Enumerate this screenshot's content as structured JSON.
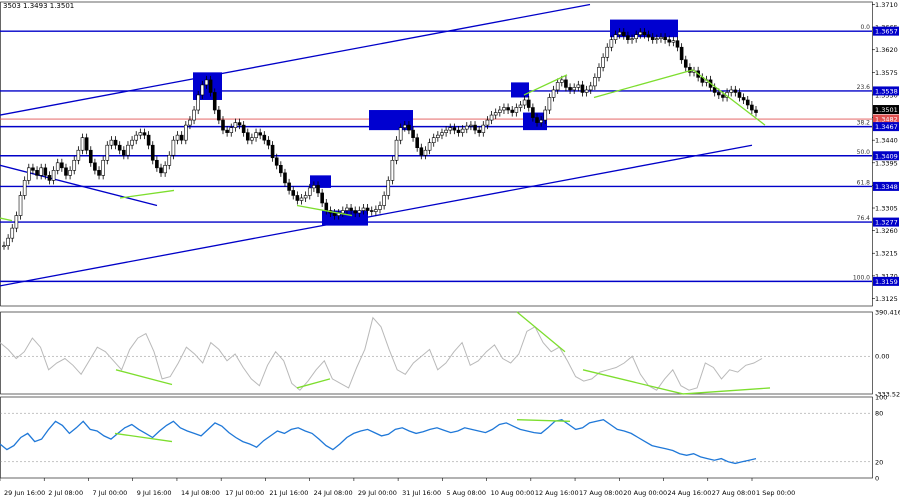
{
  "header": {
    "quote": "3503 1.3493 1.3501"
  },
  "colors": {
    "background": "#ffffff",
    "candle": "#000000",
    "level_line": "#0000c8",
    "box": "#0000d0",
    "divergence": "#7dde2e",
    "red_line": "#e05050",
    "cci_line": "#b9b9b9",
    "stoch_line": "#1f78d8",
    "grid_dash": "#888888"
  },
  "chart_data": [
    {
      "type": "line",
      "name": "price",
      "instrument_quote": "1.3493 1.3501",
      "x_labels": [
        "29 Jun 16:00",
        "2 Jul 08:00",
        "7 Jul 00:00",
        "9 Jul 16:00",
        "14 Jul 08:00",
        "17 Jul 00:00",
        "21 Jul 16:00",
        "24 Jul 08:00",
        "29 Jul 00:00",
        "31 Jul 16:00",
        "5 Aug 08:00",
        "10 Aug 00:00",
        "12 Aug 16:00",
        "17 Aug 08:00",
        "20 Aug 00:00",
        "24 Aug 16:00",
        "27 Aug 08:00",
        "1 Sep 00:00"
      ],
      "y_ticks": [
        1.3125,
        1.317,
        1.3215,
        1.326,
        1.3305,
        1.335,
        1.3395,
        1.344,
        1.3485,
        1.353,
        1.3575,
        1.362,
        1.3665,
        1.371
      ],
      "ylim": [
        1.311,
        1.3715
      ],
      "current_price": 1.3501,
      "red_line_price": 1.3482,
      "fib_levels": [
        {
          "label": "0.0",
          "price": 1.3657
        },
        {
          "label": "23.6",
          "price": 1.3538
        },
        {
          "label": "38.2",
          "price": 1.3467
        },
        {
          "label": "50.0",
          "price": 1.3409
        },
        {
          "label": "61.8",
          "price": 1.3348
        },
        {
          "label": "76.4",
          "price": 1.3277
        },
        {
          "label": "100.0",
          "price": 1.3159
        }
      ],
      "channel": {
        "upper_start": 1.349,
        "upper_end": 1.371,
        "lower_start": 1.315,
        "lower_end": 1.343
      },
      "series": [
        {
          "values": [
            1.323,
            1.3245,
            1.3265,
            1.329,
            1.333,
            1.336,
            1.3385,
            1.338,
            1.337,
            1.3385,
            1.337,
            1.336,
            1.338,
            1.3395,
            1.3385,
            1.337,
            1.338,
            1.34,
            1.342,
            1.3445,
            1.342,
            1.3395,
            1.338,
            1.337,
            1.34,
            1.343,
            1.344,
            1.343,
            1.342,
            1.341,
            1.343,
            1.344,
            1.345,
            1.3455,
            1.345,
            1.343,
            1.34,
            1.3385,
            1.3375,
            1.339,
            1.341,
            1.344,
            1.345,
            1.344,
            1.347,
            1.348,
            1.35,
            1.353,
            1.355,
            1.356,
            1.3535,
            1.35,
            1.348,
            1.346,
            1.3455,
            1.3465,
            1.3475,
            1.347,
            1.3455,
            1.344,
            1.3445,
            1.3455,
            1.345,
            1.344,
            1.343,
            1.3405,
            1.339,
            1.3375,
            1.3355,
            1.334,
            1.333,
            1.332,
            1.3325,
            1.333,
            1.3345,
            1.335,
            1.3335,
            1.3315,
            1.33,
            1.3295,
            1.329,
            1.3295,
            1.33,
            1.3305,
            1.33,
            1.3295,
            1.33,
            1.3305,
            1.33,
            1.3298,
            1.3302,
            1.331,
            1.333,
            1.336,
            1.34,
            1.344,
            1.3465,
            1.347,
            1.346,
            1.3445,
            1.3425,
            1.341,
            1.342,
            1.3435,
            1.3445,
            1.345,
            1.3455,
            1.346,
            1.3465,
            1.346,
            1.3455,
            1.3462,
            1.3468,
            1.347,
            1.346,
            1.3455,
            1.347,
            1.348,
            1.349,
            1.3495,
            1.35,
            1.3505,
            1.35,
            1.3495,
            1.3505,
            1.351,
            1.352,
            1.3505,
            1.3485,
            1.3475,
            1.348,
            1.35,
            1.3525,
            1.354,
            1.3555,
            1.356,
            1.3545,
            1.354,
            1.3545,
            1.355,
            1.3535,
            1.354,
            1.3548,
            1.3565,
            1.3585,
            1.3605,
            1.3625,
            1.364,
            1.365,
            1.3655,
            1.3648,
            1.364,
            1.3642,
            1.365,
            1.3655,
            1.365,
            1.3645,
            1.364,
            1.3642,
            1.3645,
            1.364,
            1.3635,
            1.3638,
            1.3625,
            1.36,
            1.3585,
            1.3575,
            1.3578,
            1.3565,
            1.3555,
            1.356,
            1.3545,
            1.3535,
            1.353,
            1.3525,
            1.3535,
            1.354,
            1.3535,
            1.3525,
            1.352,
            1.351,
            1.35,
            1.3495
          ]
        }
      ]
    },
    {
      "type": "line",
      "name": "cci",
      "y_ticks_text": [
        "390.4163",
        "0.00",
        "-333.522"
      ],
      "ylim": [
        -333.522,
        390.4163
      ],
      "series": [
        {
          "values": [
            120,
            60,
            -20,
            40,
            160,
            80,
            -120,
            -60,
            -20,
            -80,
            -160,
            -40,
            80,
            40,
            -40,
            -120,
            60,
            160,
            200,
            40,
            -200,
            -180,
            -60,
            80,
            20,
            -60,
            120,
            60,
            -40,
            20,
            -100,
            -200,
            -260,
            -80,
            40,
            -40,
            -240,
            -300,
            -220,
            -120,
            -40,
            -200,
            -240,
            -280,
            -100,
            60,
            340,
            260,
            60,
            -120,
            -160,
            -60,
            0,
            60,
            -120,
            -60,
            40,
            120,
            -80,
            -40,
            40,
            100,
            -20,
            -60,
            20,
            220,
            260,
            120,
            40,
            80,
            -40,
            -180,
            -220,
            -200,
            -140,
            -120,
            -100,
            -60,
            0,
            -160,
            -260,
            -300,
            -200,
            -120,
            -260,
            -300,
            -280,
            -60,
            -100,
            -200,
            -120,
            -140,
            -80,
            -60,
            -20
          ]
        }
      ],
      "note": ""
    },
    {
      "type": "line",
      "name": "stochastic",
      "y_ticks_text": [
        "100",
        "80",
        "20",
        "0"
      ],
      "ylim": [
        0,
        100
      ],
      "series": [
        {
          "values": [
            42,
            35,
            40,
            50,
            55,
            45,
            48,
            60,
            70,
            65,
            55,
            62,
            70,
            60,
            58,
            52,
            48,
            55,
            62,
            66,
            60,
            55,
            50,
            58,
            65,
            70,
            62,
            58,
            55,
            52,
            60,
            68,
            64,
            56,
            50,
            45,
            42,
            38,
            46,
            52,
            58,
            55,
            60,
            62,
            58,
            55,
            48,
            40,
            35,
            42,
            50,
            55,
            58,
            60,
            56,
            52,
            54,
            60,
            62,
            58,
            55,
            57,
            60,
            62,
            59,
            56,
            58,
            62,
            60,
            58,
            56,
            60,
            66,
            68,
            64,
            60,
            58,
            56,
            55,
            62,
            70,
            72,
            66,
            60,
            62,
            68,
            70,
            72,
            66,
            60,
            58,
            55,
            50,
            45,
            40,
            38,
            36,
            34,
            30,
            28,
            30,
            26,
            24,
            22,
            24,
            20,
            18,
            20,
            22,
            24
          ]
        }
      ]
    }
  ]
}
